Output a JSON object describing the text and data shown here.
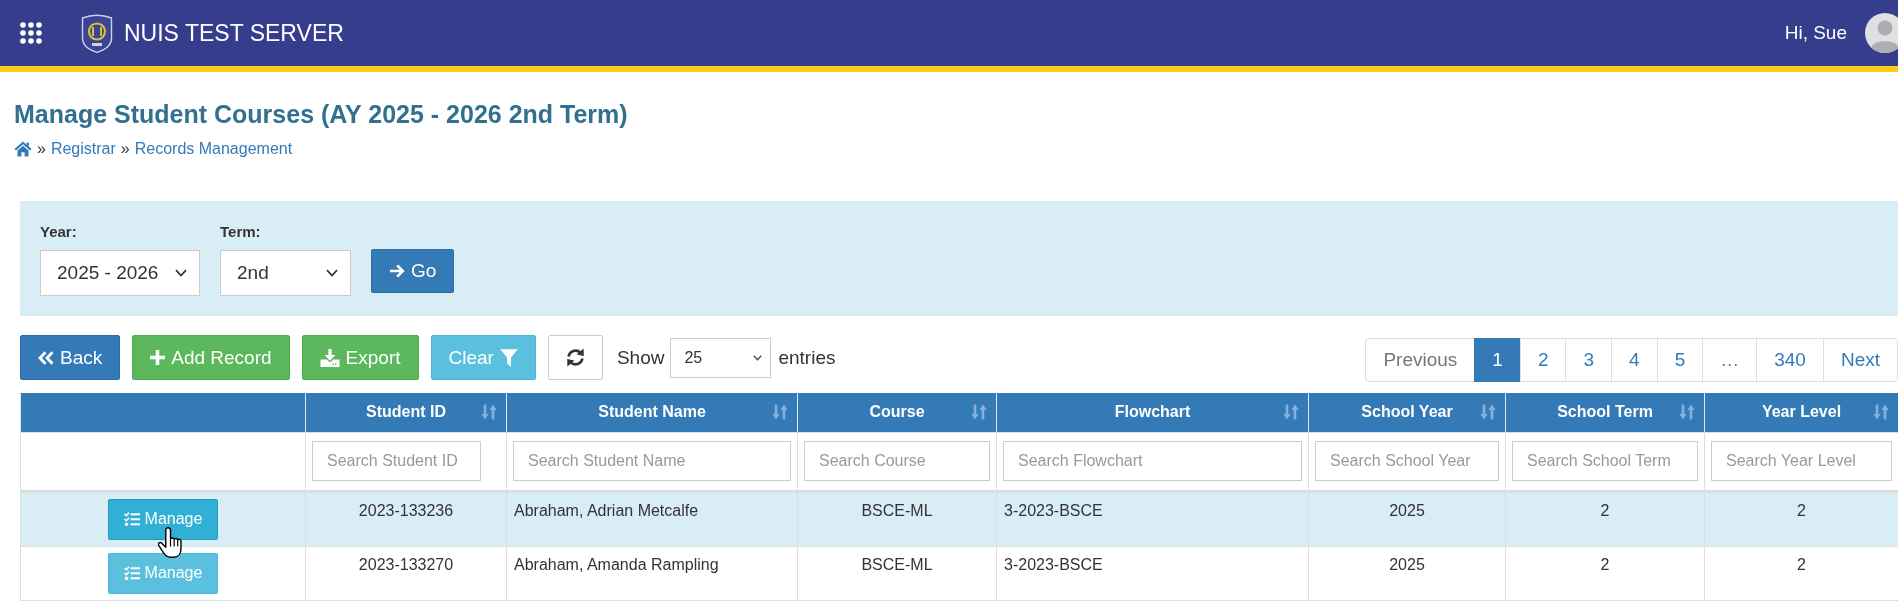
{
  "header": {
    "title": "NUIS TEST SERVER",
    "greeting": "Hi, Sue"
  },
  "page": {
    "title": "Manage Student Courses (AY 2025 - 2026 2nd Term)",
    "breadcrumb": [
      {
        "kind": "home"
      },
      {
        "kind": "separator",
        "text": "»"
      },
      {
        "kind": "link",
        "text": "Registrar"
      },
      {
        "kind": "separator",
        "text": "»"
      },
      {
        "kind": "link",
        "text": "Records Management"
      }
    ]
  },
  "filter": {
    "fields": [
      {
        "label": "Year:",
        "value": "2025 - 2026"
      },
      {
        "label": "Term:",
        "value": "2nd"
      }
    ],
    "submit": "Go"
  },
  "toolbar": {
    "buttons": [
      {
        "kind": "back",
        "label": "Back"
      },
      {
        "kind": "add",
        "label": "Add Record"
      },
      {
        "kind": "export",
        "label": "Export"
      },
      {
        "kind": "clear",
        "label": "Clear"
      },
      {
        "kind": "refresh"
      }
    ],
    "length_menu": {
      "before": "Show",
      "value": "25",
      "after": "entries"
    }
  },
  "pagination": [
    {
      "label": "Previous",
      "selected": false,
      "disabled": true
    },
    {
      "label": "1",
      "selected": true,
      "disabled": false
    },
    {
      "label": "2",
      "selected": false,
      "disabled": false
    },
    {
      "label": "3",
      "selected": false,
      "disabled": false
    },
    {
      "label": "4",
      "selected": false,
      "disabled": false
    },
    {
      "label": "5",
      "selected": false,
      "disabled": false
    },
    {
      "label": "…",
      "selected": false,
      "disabled": true
    },
    {
      "label": "340",
      "selected": false,
      "disabled": false
    },
    {
      "label": "Next",
      "selected": false,
      "disabled": false
    }
  ],
  "table": {
    "columns": [
      {
        "title": "Student ID",
        "placeholder": "Search Student ID"
      },
      {
        "title": "Student Name",
        "placeholder": "Search Student Name"
      },
      {
        "title": "Course",
        "placeholder": "Search Course"
      },
      {
        "title": "Flowchart",
        "placeholder": "Search Flowchart"
      },
      {
        "title": "School Year",
        "placeholder": "Search School Year"
      },
      {
        "title": "School Term",
        "placeholder": "Search School Term"
      },
      {
        "title": "Year Level",
        "placeholder": "Search Year Level"
      }
    ],
    "rows": [
      {
        "hovered": true,
        "action": "Manage",
        "cells": [
          "2023-133236",
          "Abraham, Adrian Metcalfe",
          "BSCE-ML",
          "3-2023-BSCE",
          "2025",
          "2",
          "2"
        ]
      },
      {
        "hovered": false,
        "action": "Manage",
        "cells": [
          "2023-133270",
          "Abraham, Amanda Rampling",
          "BSCE-ML",
          "3-2023-BSCE",
          "2025",
          "2",
          "2"
        ]
      }
    ]
  }
}
